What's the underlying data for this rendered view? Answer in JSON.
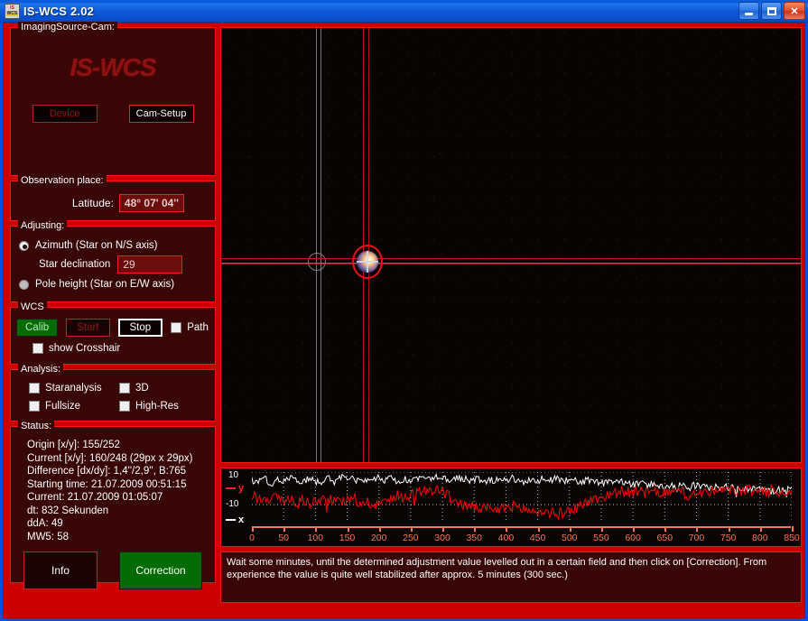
{
  "window": {
    "title": "IS-WCS 2.02",
    "icon": "app-icon",
    "minimize_label": "Minimize",
    "maximize_label": "Maximize",
    "close_label": "Close",
    "close_glyph": "✕"
  },
  "colors": {
    "panel_bg": "#380606",
    "panel_border": "#ff1414",
    "client_bg": "#cc0000",
    "accent_red": "#cc0000",
    "titlebar_blue": "#0d5ad8",
    "green_button": "#046b04",
    "trace_x": "#ffffff",
    "trace_y": "#ff0000",
    "axis": "#ef7a52"
  },
  "camera_panel": {
    "legend": "ImagingSource-Cam:",
    "logo": "IS-WCS",
    "device_button": "Device",
    "device_enabled": false,
    "cam_setup_button": "Cam-Setup",
    "cam_setup_enabled": true
  },
  "observation": {
    "legend": "Observation place:",
    "latitude_label": "Latitude:",
    "latitude_value": "48° 07' 04''"
  },
  "adjusting": {
    "legend": "Adjusting:",
    "azimuth_label": "Azimuth (Star on N/S axis)",
    "azimuth_selected": true,
    "star_declination_label": "Star declination",
    "star_declination_value": "29",
    "pole_height_label": "Pole height (Star on E/W axis)",
    "pole_height_selected": false
  },
  "wcs": {
    "legend": "WCS",
    "calib_button": "Calib",
    "start_button": "Start",
    "stop_button": "Stop",
    "path_label": "Path",
    "path_checked": false,
    "show_crosshair_label": "show Crosshair",
    "show_crosshair_checked": false
  },
  "analysis": {
    "legend": "Analysis:",
    "items": [
      {
        "label": "Staranalysis",
        "checked": false
      },
      {
        "label": "3D",
        "checked": false
      },
      {
        "label": "Fullsize",
        "checked": false
      },
      {
        "label": "High-Res",
        "checked": false
      }
    ]
  },
  "status": {
    "legend": "Status:",
    "lines": [
      "Origin [x/y]: 155/252",
      "Current [x/y]: 160/248 (29px x 29px)",
      "Difference [dx/dy]: 1,4''/2,9'', B:765",
      "Starting time: 21.07.2009 00:51:15",
      "Current: 21.07.2009 01:05:07",
      "dt: 832 Sekunden",
      "ddA: 49",
      "MW5: 58"
    ],
    "info_button": "Info",
    "correction_button": "Correction"
  },
  "camera_view": {
    "name": "camera-preview",
    "target_circle": "red-target-circle",
    "reference_circle": "gray-reference-circle",
    "star": "star-blob"
  },
  "hint": {
    "text": "Wait some minutes, until the determined adjustment value levelled out in a certain field and then click on [Correction]. From experience the value is quite well stabilized after approx. 5 minutes (300 sec.)"
  },
  "chart_data": {
    "type": "line",
    "title": "",
    "xlabel": "",
    "ylabel": "",
    "xlim": [
      0,
      850
    ],
    "ylim": [
      -20,
      10
    ],
    "yticks": [
      10,
      -10
    ],
    "ytick_labels": [
      "10",
      "-10"
    ],
    "xticks": [
      0,
      50,
      100,
      150,
      200,
      250,
      300,
      350,
      400,
      450,
      500,
      550,
      600,
      650,
      700,
      750,
      800,
      850
    ],
    "xtick_labels": [
      "0",
      "50",
      "100",
      "150",
      "200",
      "250",
      "300",
      "350",
      "400",
      "450",
      "500",
      "550",
      "600",
      "650",
      "700",
      "750",
      "800",
      "850"
    ],
    "grid": true,
    "legend_position": "left",
    "series": [
      {
        "name": "x",
        "color": "#ffffff",
        "legend_label": "x",
        "x": [
          0,
          10,
          20,
          30,
          40,
          50,
          60,
          70,
          80,
          90,
          100,
          110,
          120,
          130,
          140,
          150,
          160,
          170,
          180,
          190,
          200,
          210,
          220,
          230,
          240,
          250,
          260,
          270,
          280,
          290,
          300,
          310,
          320,
          330,
          340,
          350,
          360,
          370,
          380,
          390,
          400,
          410,
          420,
          430,
          440,
          450,
          460,
          470,
          480,
          490,
          500,
          510,
          520,
          530,
          540,
          550,
          560,
          570,
          580,
          590,
          600,
          610,
          620,
          630,
          640,
          650,
          660,
          670,
          680,
          690,
          700,
          710,
          720,
          730,
          740,
          750,
          760,
          770,
          780,
          790,
          800,
          810,
          820,
          830
        ],
        "values": [
          5,
          4,
          6,
          3,
          5,
          4,
          6,
          5,
          3,
          6,
          4,
          5,
          6,
          4,
          7,
          5,
          6,
          4,
          6,
          5,
          7,
          5,
          6,
          4,
          6,
          5,
          7,
          6,
          5,
          7,
          6,
          5,
          7,
          6,
          5,
          6,
          5,
          6,
          5,
          6,
          5,
          6,
          5,
          4,
          6,
          5,
          6,
          5,
          6,
          5,
          4,
          5,
          4,
          5,
          4,
          3,
          4,
          3,
          4,
          3,
          2,
          3,
          2,
          3,
          2,
          1,
          2,
          1,
          2,
          1,
          2,
          1,
          0,
          1,
          0,
          1,
          0,
          -1,
          0,
          -1,
          0,
          -1,
          -2,
          -1
        ]
      },
      {
        "name": "y",
        "color": "#ff0000",
        "legend_label": "y",
        "x": [
          0,
          10,
          20,
          30,
          40,
          50,
          60,
          70,
          80,
          90,
          100,
          110,
          120,
          130,
          140,
          150,
          160,
          170,
          180,
          190,
          200,
          210,
          220,
          230,
          240,
          250,
          260,
          270,
          280,
          290,
          300,
          310,
          320,
          330,
          340,
          350,
          360,
          370,
          380,
          390,
          400,
          410,
          420,
          430,
          440,
          450,
          460,
          470,
          480,
          490,
          500,
          510,
          520,
          530,
          540,
          550,
          560,
          570,
          580,
          590,
          600,
          610,
          620,
          630,
          640,
          650,
          660,
          670,
          680,
          690,
          700,
          710,
          720,
          730,
          740,
          750,
          760,
          770,
          780,
          790,
          800,
          810,
          820,
          830
        ],
        "values": [
          -4,
          -6,
          -5,
          -7,
          -5,
          -8,
          -6,
          -10,
          -7,
          -9,
          -8,
          -7,
          -8,
          -6,
          -7,
          -8,
          -7,
          -9,
          -8,
          -10,
          -9,
          -8,
          -7,
          -6,
          -5,
          -4,
          -3,
          -2,
          -1,
          0,
          -2,
          -5,
          -8,
          -10,
          -11,
          -12,
          -12,
          -13,
          -14,
          -13,
          -12,
          -11,
          -12,
          -13,
          -14,
          -15,
          -14,
          -15,
          -16,
          -15,
          -14,
          -12,
          -10,
          -8,
          -7,
          -6,
          -4,
          -3,
          -2,
          -2,
          -3,
          -2,
          -3,
          -2,
          -3,
          -2,
          -3,
          -2,
          -3,
          -6,
          -3,
          -2,
          -3,
          -2,
          -1,
          -2,
          -1,
          -2,
          -1,
          -2,
          -1,
          -2,
          -1,
          -2
        ]
      }
    ]
  }
}
